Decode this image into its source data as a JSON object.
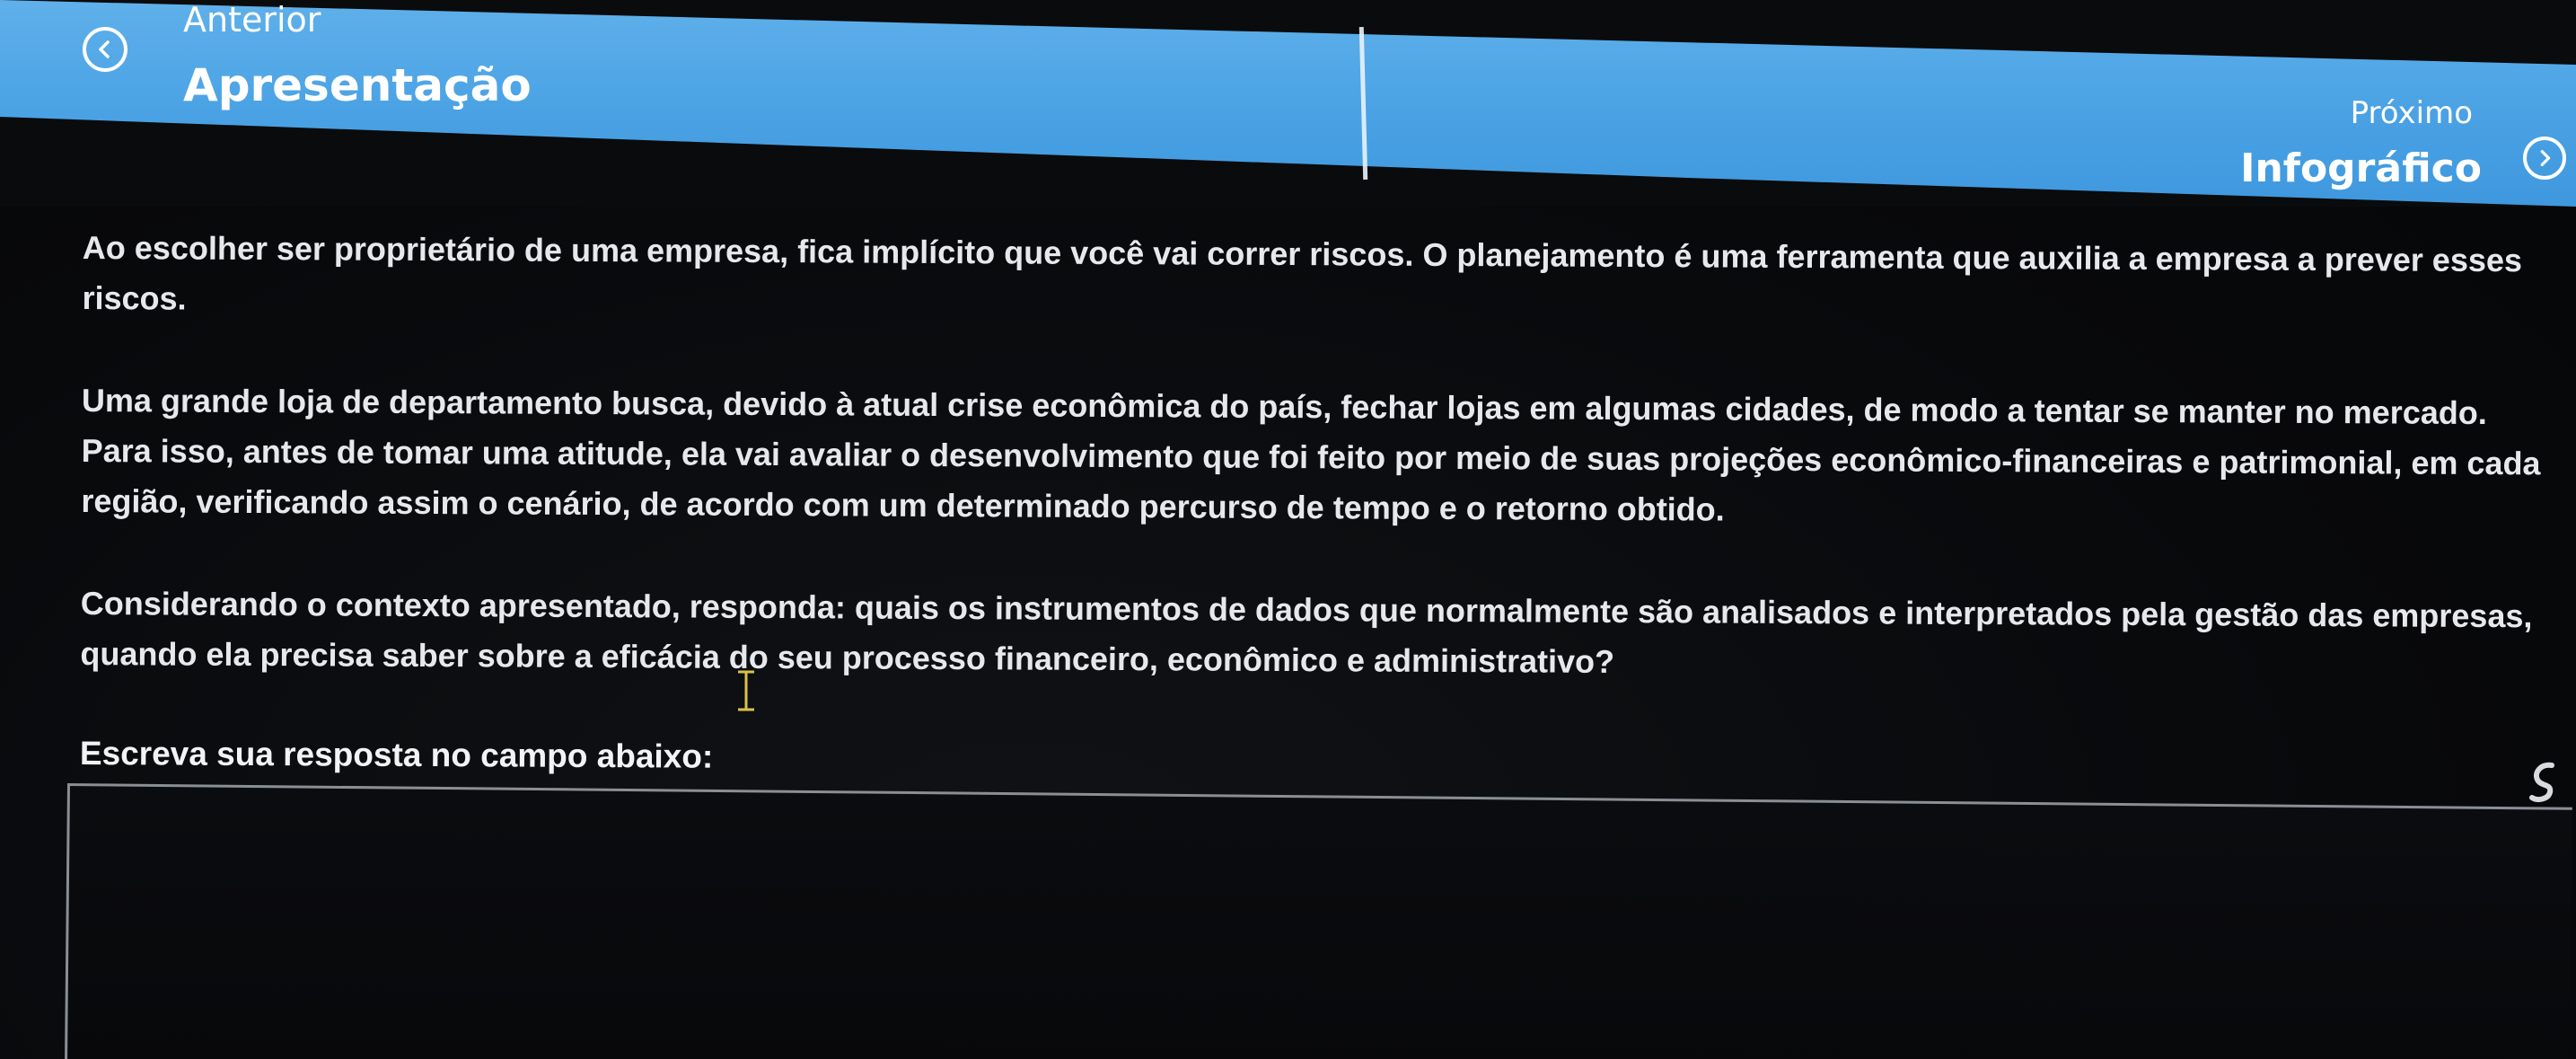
{
  "nav": {
    "prev_small": "Anterior",
    "prev_title": "Apresentação",
    "next_small": "Próximo",
    "next_title": "Infográfico",
    "accent_color": "#4aa2e4"
  },
  "content": {
    "paragraphs": [
      "Ao escolher ser proprietário de uma empresa, fica implícito que você vai correr riscos. O planejamento é uma ferramenta que auxilia a empresa a prever esses riscos.",
      "Uma grande loja de departamento busca, devido à atual crise econômica do país, fechar lojas em algumas cidades, de modo a tentar se manter no mercado. Para isso, antes de tomar uma atitude, ela vai avaliar o desenvolvimento que foi feito por meio de suas projeções econômico-financeiras e patrimonial, em cada região, verificando assim o cenário, de acordo com um determinado percurso de tempo e o retorno obtido.",
      "Considerando o contexto apresentado, responda: quais os instrumentos de dados que normalmente são analisados e interpretados pela gestão das empresas, quando ela precisa saber sobre a eficácia do seu processo financeiro, econômico e administrativo?"
    ],
    "answer_label": "Escreva sua resposta no campo abaixo:"
  },
  "icons": {
    "prev": "chevron-left-circle-icon",
    "next": "chevron-right-circle-icon",
    "cursor": "text-cursor-icon",
    "assist": "assistant-icon"
  }
}
